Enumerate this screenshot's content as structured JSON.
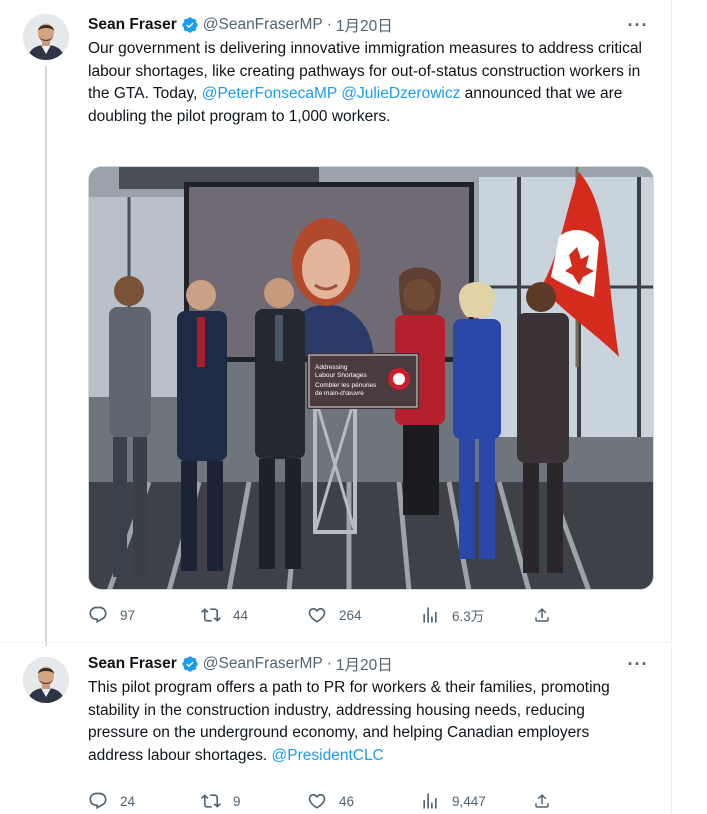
{
  "tweets": [
    {
      "author": {
        "display_name": "Sean Fraser",
        "handle": "@SeanFraserMP",
        "verified": true
      },
      "time": "1月20日",
      "text_parts": [
        "Our government is delivering innovative immigration measures to address critical labour shortages, like creating pathways for out-of-status construction workers in the GTA. Today, ",
        "@PeterFonsecaMP",
        " ",
        "@JulieDzerowicz",
        " announced that we are doubling the pilot program to 1,000 workers."
      ],
      "media": {
        "sign_line1": "Addressing",
        "sign_line2": "Labour Shortages",
        "sign_line3": "Combler les pénuries",
        "sign_line4": "de main-d'œuvre"
      },
      "stats": {
        "replies": "97",
        "retweets": "44",
        "likes": "264",
        "views": "6.3万"
      }
    },
    {
      "author": {
        "display_name": "Sean Fraser",
        "handle": "@SeanFraserMP",
        "verified": true
      },
      "time": "1月20日",
      "text_parts": [
        "This pilot program offers a path to PR for workers & their families, promoting stability in the construction industry, addressing housing needs, reducing pressure on the underground economy, and helping Canadian employers address labour shortages. ",
        "@PresidentCLC"
      ],
      "stats": {
        "replies": "24",
        "retweets": "9",
        "likes": "46",
        "views": "9,447"
      }
    }
  ],
  "colors": {
    "link": "#1d9bf0",
    "secondary_text": "#536471",
    "verified": "#1d9bf0",
    "thread_line": "#cfd9de"
  },
  "icons": [
    "more-icon",
    "verified-badge-icon",
    "reply-icon",
    "retweet-icon",
    "like-icon",
    "views-icon",
    "share-icon"
  ]
}
